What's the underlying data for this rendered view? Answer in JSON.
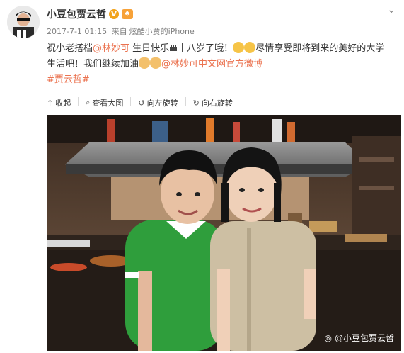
{
  "user": {
    "name": "小豆包贾云哲",
    "verified_badge": "V",
    "level_badge": "♠"
  },
  "meta": {
    "time": "2017-7-1 01:15",
    "from_label": "来自",
    "source": "炫酷小贾的iPhone"
  },
  "post": {
    "text_1": "祝小老搭档",
    "mention_1": "@林妙可",
    "text_2": " 生日快乐",
    "text_3": "十八岁了哦！",
    "text_4": "尽情享受即将到来的美好的大学生活吧！我们继续加油",
    "mention_2": "@林妙可中文网官方微博",
    "hashtag": "#贾云哲#"
  },
  "toolbar": {
    "collapse": "收起",
    "view_large": "查看大图",
    "rotate_left": "向左旋转",
    "rotate_right": "向右旋转"
  },
  "image": {
    "watermark": "@小豆包贾云哲"
  },
  "icons": {
    "collapse": "arrow-up-icon",
    "view_large": "magnifier-icon",
    "rotate_left": "rotate-left-icon",
    "rotate_right": "rotate-right-icon",
    "more": "chevron-down-icon"
  },
  "colors": {
    "link": "#eb7350",
    "badge": "#f2a31b",
    "meta": "#808080"
  }
}
